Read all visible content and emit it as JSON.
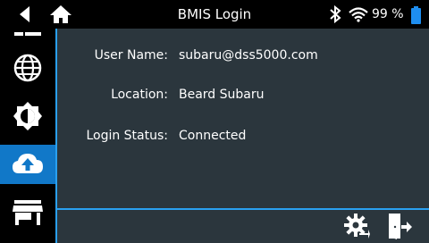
{
  "header": {
    "title": "BMIS Login",
    "battery_percent": "99 %"
  },
  "sidebar": {
    "items": [
      {
        "icon": "partial-item-icon"
      },
      {
        "icon": "globe-icon"
      },
      {
        "icon": "brightness-icon"
      },
      {
        "icon": "cloud-upload-icon",
        "active": true
      },
      {
        "icon": "store-icon"
      }
    ]
  },
  "details": {
    "user_name_label": "User Name:",
    "user_name_value": "subaru@dss5000.com",
    "location_label": "Location:",
    "location_value": "Beard Subaru",
    "login_status_label": "Login Status:",
    "login_status_value": "Connected"
  },
  "colors": {
    "background": "#2b363d",
    "bars": "#000000",
    "accent": "#1178c8",
    "divider": "#2aa0f0"
  }
}
